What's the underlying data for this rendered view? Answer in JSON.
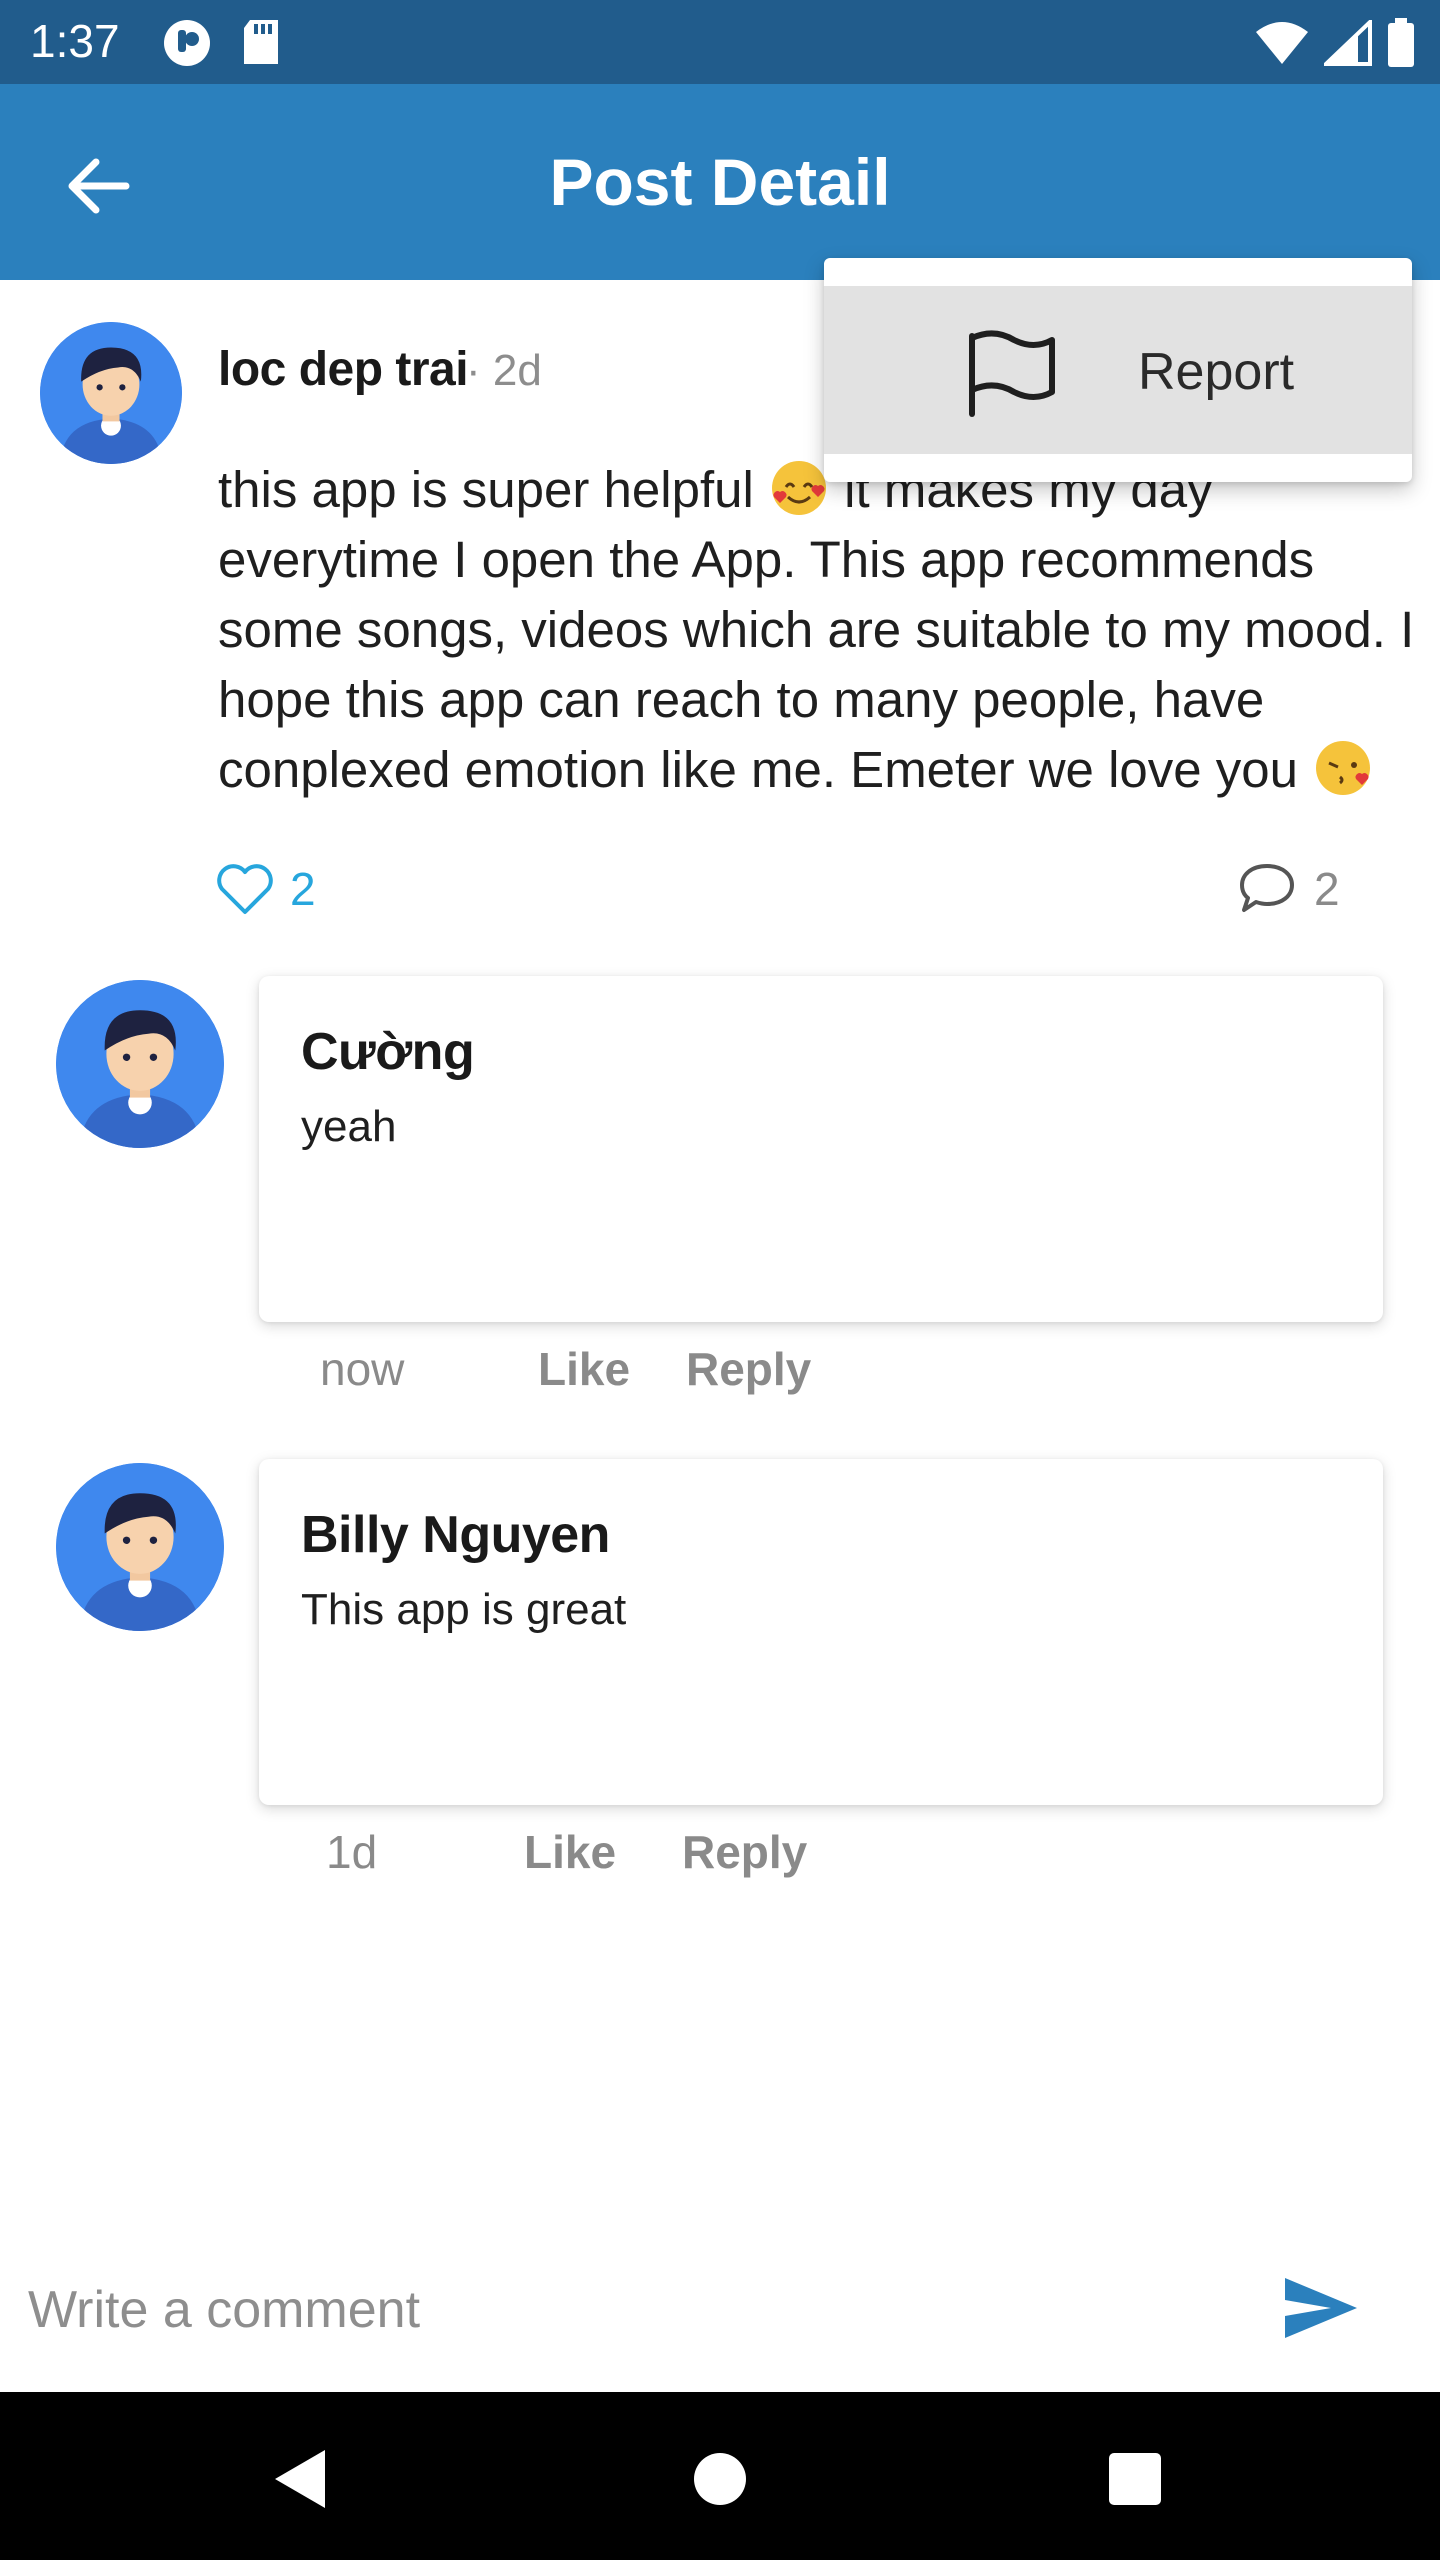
{
  "status_bar": {
    "time": "1:37",
    "left_icons": [
      "notification-app-icon",
      "sd-card-icon"
    ],
    "right_icons": [
      "wifi-icon",
      "cell-signal-icon",
      "battery-icon"
    ]
  },
  "app_bar": {
    "title": "Post Detail",
    "back_icon": "arrow-left-icon"
  },
  "post": {
    "author": "loc dep trai",
    "time": "· 2d",
    "body_part1": "this app is super helpful ",
    "body_part2": " it makes my day everytime I open the App. This app recommends some songs, videos which are suitable to my mood. I hope this app can reach to many people, have conplexed emotion like me. Emeter we love you ",
    "like_count": "2",
    "comment_count": "2"
  },
  "comments": [
    {
      "name": "Cường",
      "text": "yeah",
      "time": "now",
      "like_label": "Like",
      "reply_label": "Reply"
    },
    {
      "name": "Billy Nguyen",
      "text": "This app is great",
      "time": "1d",
      "like_label": "Like",
      "reply_label": "Reply"
    }
  ],
  "composer": {
    "placeholder": "Write a comment"
  },
  "menu": {
    "items": [
      {
        "label": "Report",
        "icon": "flag-icon"
      }
    ]
  },
  "colors": {
    "status_bar": "#215c8c",
    "app_bar": "#2b80bd",
    "like_accent": "#27a6dd",
    "send_accent": "#2b80bd"
  }
}
